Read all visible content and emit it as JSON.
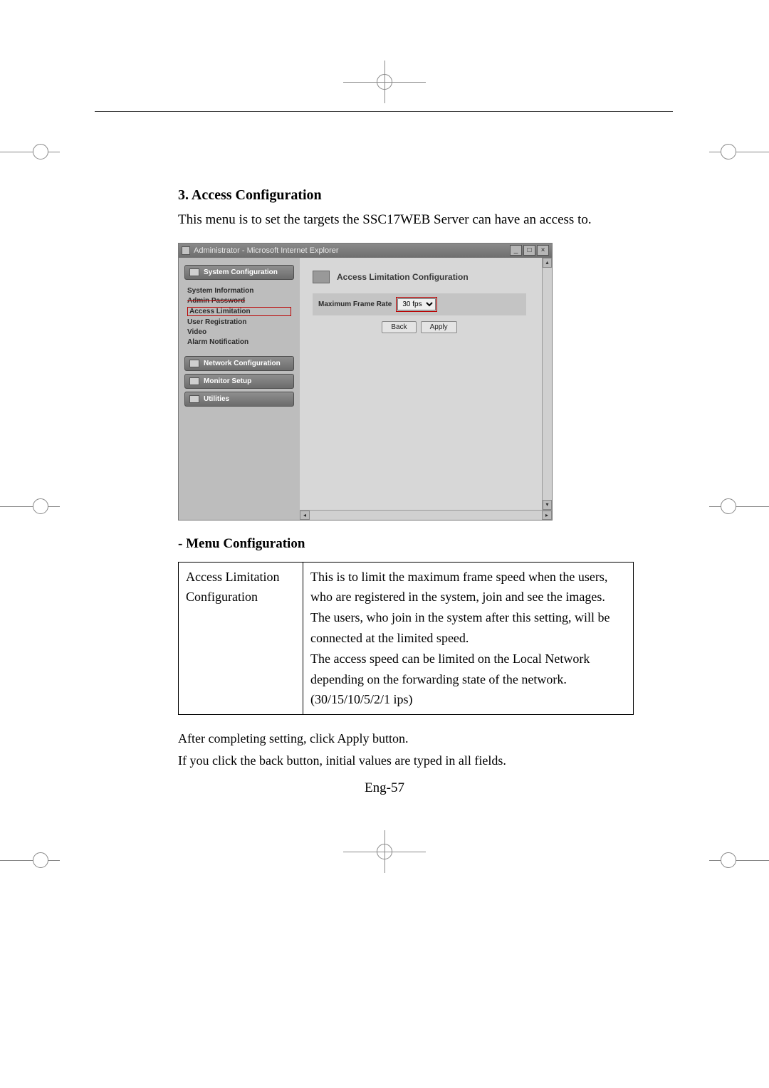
{
  "section": {
    "heading": "3. Access Configuration",
    "intro": "This menu is to set the targets the SSC17WEB Server can have an access to."
  },
  "window": {
    "title": "Administrator - Microsoft Internet Explorer",
    "controls": {
      "min": "_",
      "max": "□",
      "close": "×"
    }
  },
  "sidebar": {
    "groups": [
      {
        "label": "System Configuration",
        "items": [
          "System Information",
          "Admin Password",
          "Access Limitation",
          "User Registration",
          "Video",
          "Alarm Notification"
        ],
        "highlighted": "Access Limitation"
      },
      {
        "label": "Network Configuration",
        "items": []
      },
      {
        "label": "Monitor Setup",
        "items": []
      },
      {
        "label": "Utilities",
        "items": []
      }
    ]
  },
  "panel": {
    "title": "Access Limitation Configuration",
    "field_label": "Maximum Frame Rate",
    "field_value": "30 fps",
    "back": "Back",
    "apply": "Apply"
  },
  "menu": {
    "heading": "- Menu Configuration",
    "row_label_1": "Access Limitation",
    "row_label_2": "Configuration",
    "desc": "This is to limit the maximum frame speed when the users, who are registered in the system, join and see the images.\nThe users, who join in the system after this setting, will be connected at the limited speed.\nThe access speed can be limited on the Local Network depending on the forwarding state of the network. (30/15/10/5/2/1 ips)"
  },
  "after": {
    "l1": "After completing setting, click Apply button.",
    "l2": "If you click the back button, initial values are typed in all fields."
  },
  "page_number": "Eng-57"
}
